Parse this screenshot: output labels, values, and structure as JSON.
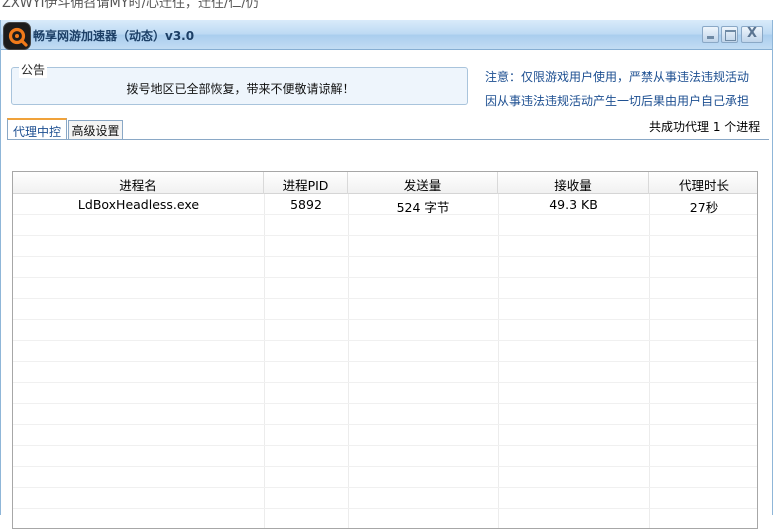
{
  "top_fragment": "ZXWYI伊斗佣召请MY时/心迁住，迁住/仁/仍",
  "window": {
    "title": "畅享网游加速器（动态）v3.0",
    "close_glyph": "X"
  },
  "notice": {
    "legend": "公告",
    "text": "拨号地区已全部恢复，带来不便敬请谅解！"
  },
  "warnings": [
    "注意：仅限游戏用户使用，严禁从事违法违规活动",
    "因从事违法违规活动产生一切后果由用户自己承担"
  ],
  "tabs": [
    {
      "label": "代理中控",
      "active": true
    },
    {
      "label": "高级设置",
      "active": false
    }
  ],
  "status_text": "共成功代理 1 个进程",
  "table": {
    "headers": [
      "进程名",
      "进程PID",
      "发送量",
      "接收量",
      "代理时长"
    ],
    "rows": [
      [
        "LdBoxHeadless.exe",
        "5892",
        "524 字节",
        "49.3 KB",
        "27秒"
      ]
    ]
  },
  "colors": {
    "title_text": "#1c3f66",
    "warning_text": "#1d4f91",
    "active_tab_accent": "#f0a23a",
    "logo_accent": "#f07a1a"
  },
  "icons": [
    "app-logo-icon",
    "minimize-icon",
    "maximize-icon",
    "close-icon"
  ]
}
